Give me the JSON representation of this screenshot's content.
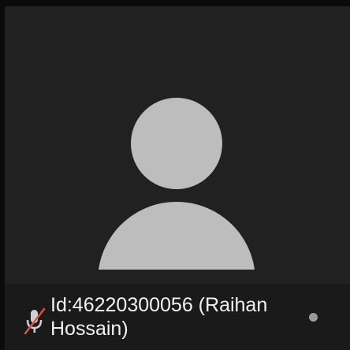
{
  "participant": {
    "name": "Id:46220300056 (Raihan Hossain)",
    "audio_icon": "mic-off-icon",
    "avatar_icon": "person-avatar-icon",
    "status_icon": "status-dot-icon"
  },
  "colors": {
    "tile_background": "#212121",
    "avatar": "#bdbdbd",
    "name_text": "#f2f2f2",
    "mic_slash": "#d9534f",
    "status_dot": "#9a9a9a"
  }
}
